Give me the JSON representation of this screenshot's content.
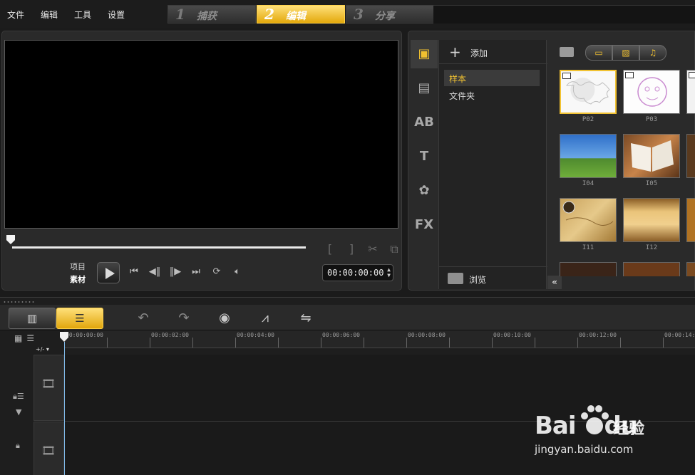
{
  "menu": [
    "文件",
    "编辑",
    "工具",
    "设置"
  ],
  "steps": [
    {
      "num": "1",
      "label": "捕获"
    },
    {
      "num": "2",
      "label": "编辑"
    },
    {
      "num": "3",
      "label": "分享"
    }
  ],
  "preview": {
    "mode_project": "项目",
    "mode_clip": "素材",
    "timecode": "00:00:00:00",
    "trim_start": "[",
    "trim_end": "]"
  },
  "library": {
    "add_label": "添加",
    "folders": [
      "样本",
      "文件夹"
    ],
    "browse_label": "浏览",
    "tabs": [
      "media-tab",
      "instant-project-tab",
      "transition-tab",
      "title-tab",
      "graphics-tab",
      "filter-tab"
    ],
    "tab_glyphs": [
      "▣",
      "▤",
      "AB",
      "T",
      "✿",
      "FX"
    ],
    "thumbnails": [
      {
        "name": "P02"
      },
      {
        "name": "P03"
      },
      {
        "name": "I04"
      },
      {
        "name": "I05"
      },
      {
        "name": "I11"
      },
      {
        "name": "I12"
      }
    ],
    "accent_color": "#f1c232"
  },
  "timeline": {
    "ruler_labels": [
      "00:00:00:00",
      "00:00:02:00",
      "00:00:04:00",
      "00:00:06:00",
      "00:00:08:00",
      "00:00:10:00",
      "00:00:12:00",
      "00:00:14:"
    ],
    "track_zoom": "+/- ▾"
  },
  "watermark": {
    "logo": "Bai",
    "logo_tail": "du",
    "cn": "经验",
    "url": "jingyan.baidu.com"
  }
}
